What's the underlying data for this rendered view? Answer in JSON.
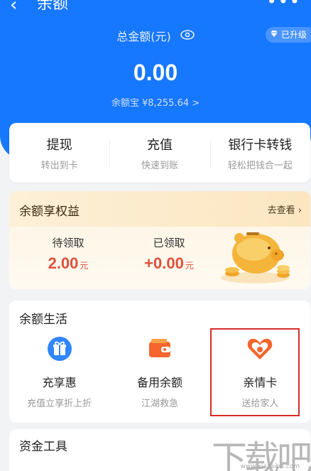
{
  "nav": {
    "back_icon": "chevron-left-icon",
    "title": "余额",
    "more_icon": "more-dots-icon"
  },
  "summary": {
    "total_label": "总金额(元)",
    "eye_icon": "eye-icon",
    "upgrade_label": "已升级",
    "upgrade_icon": "diamond-icon",
    "amount": "0.00",
    "yuebao_text": "余额宝 ¥8,255.64 >"
  },
  "actions": [
    {
      "title": "提现",
      "subtitle": "转出到卡"
    },
    {
      "title": "充值",
      "subtitle": "快速到账"
    },
    {
      "title": "银行卡转钱",
      "subtitle": "轻松把钱合一起"
    }
  ],
  "benefit": {
    "title": "余额享权益",
    "link": "去查看",
    "link_icon": "chevron-right-icon",
    "pending_label": "待领取",
    "pending_value": "2.00",
    "pending_unit": "元",
    "received_label": "已领取",
    "received_value": "+0.00",
    "received_unit": "元",
    "illustration": "piggy-bank-icon"
  },
  "life": {
    "title": "余额生活",
    "items": [
      {
        "title": "充享惠",
        "subtitle": "充值立享折上折",
        "icon": "gift-icon"
      },
      {
        "title": "备用余额",
        "subtitle": "江湖救急",
        "icon": "wallet-icon"
      },
      {
        "title": "亲情卡",
        "subtitle": "送给家人",
        "icon": "heart-icon"
      }
    ]
  },
  "tools": {
    "title": "资金工具"
  },
  "watermark": {
    "text": "下载吧",
    "url": "www.xiazaiba.com"
  },
  "colors": {
    "primary": "#1677ff",
    "accent_red": "#e0503a",
    "gold": "#fbe6c0",
    "highlight": "#d62b2b"
  }
}
